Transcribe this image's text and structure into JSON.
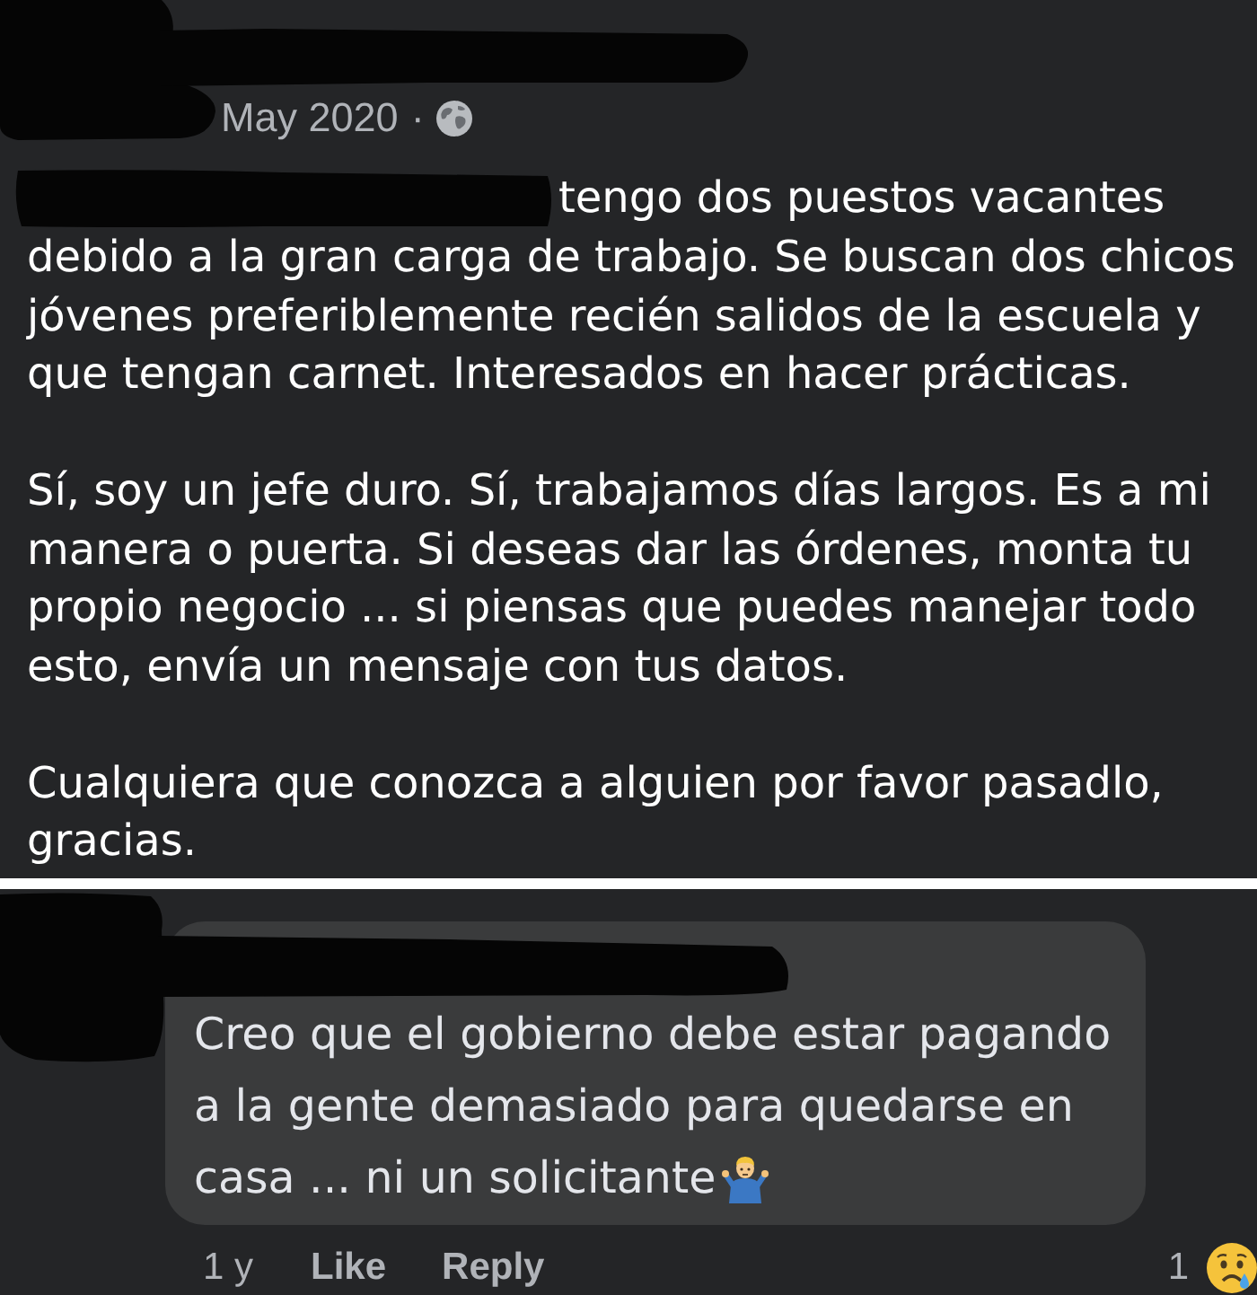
{
  "post": {
    "timestamp": "May 2020",
    "separator": "·",
    "paragraphs": [
      "tengo dos puestos vacantes debido a la gran carga de trabajo. Se buscan dos chicos jóvenes preferiblemente recién salidos de la escuela y que tengan carnet. Interesados en hacer prácticas.",
      "Sí, soy un jefe duro. Sí, trabajamos días largos. Es a mi manera o puerta. Si deseas dar las órdenes, monta tu propio negocio ... si piensas que puedes manejar todo esto, envía un mensaje con tus datos.",
      "Cualquiera que conozca a alguien por favor pasadlo, gracias."
    ]
  },
  "comment": {
    "text": "Creo que el gobierno debe estar pagando a la gente demasiado para quedarse en casa ... ni un solicitante",
    "age": "1 y",
    "actions": [
      "Like",
      "Reply"
    ],
    "reaction_count": "1"
  }
}
